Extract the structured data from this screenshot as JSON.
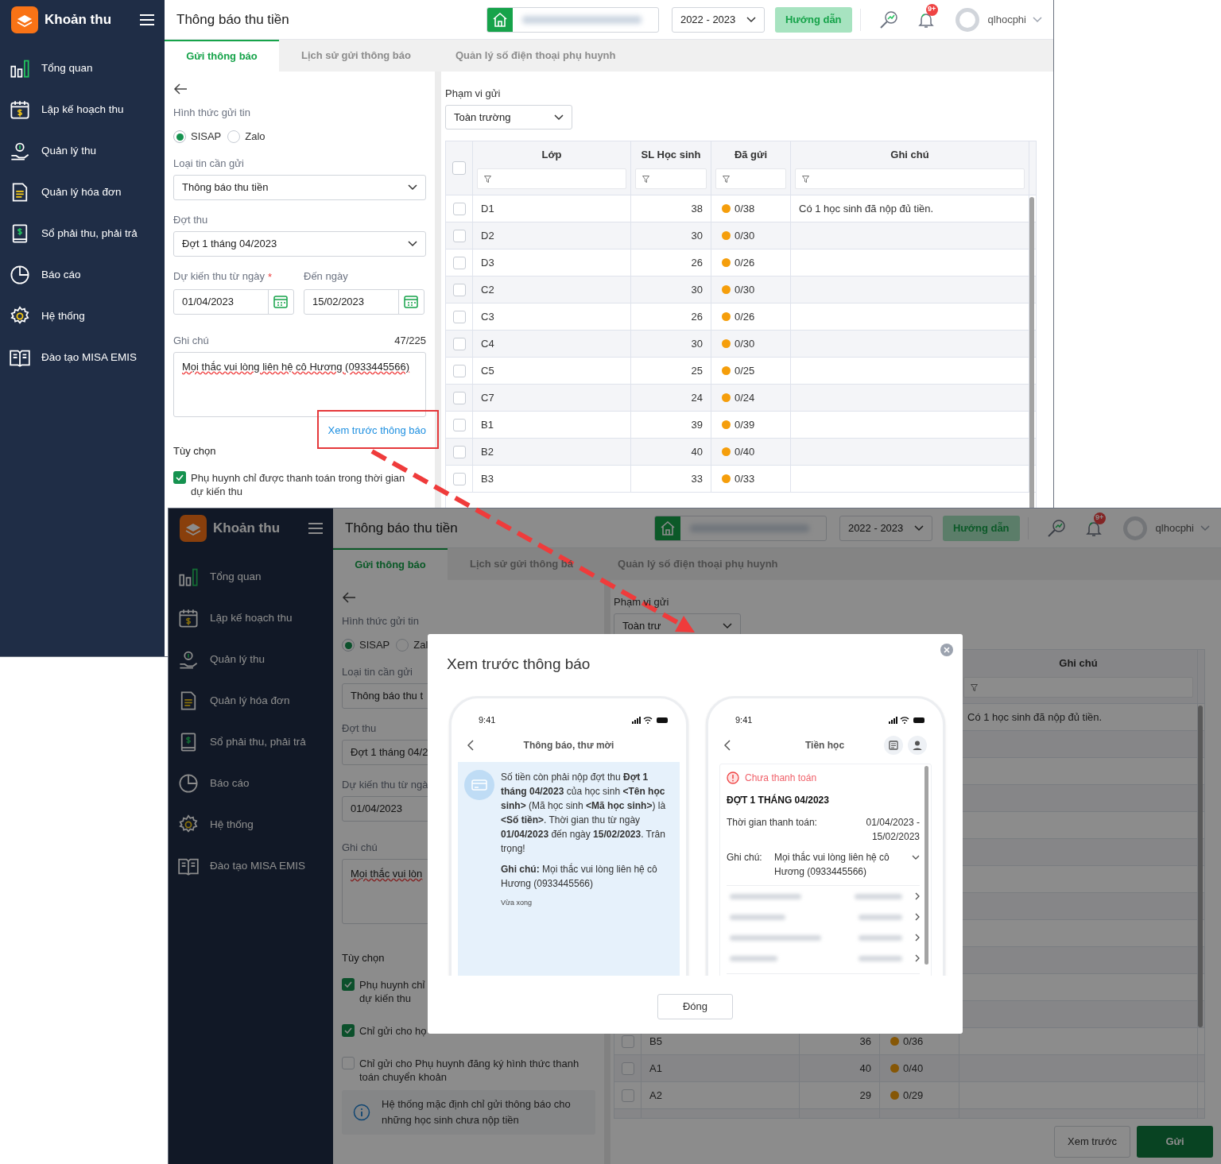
{
  "screens": [
    {
      "sidebar": {
        "app_title": "Khoản thu",
        "items": [
          {
            "label": "Tổng quan"
          },
          {
            "label": "Lập kế hoạch thu"
          },
          {
            "label": "Quản lý thu"
          },
          {
            "label": "Quản lý hóa đơn"
          },
          {
            "label": "Sổ phải thu, phải trả"
          },
          {
            "label": "Báo cáo"
          },
          {
            "label": "Hệ thống"
          },
          {
            "label": "Đào tạo MISA EMIS"
          }
        ]
      },
      "header": {
        "page_title": "Thông báo thu tiền",
        "school_year": "2022 - 2023",
        "guide_button": "Hướng dẫn",
        "notification_badge": "9+",
        "username": "qlhocphi"
      },
      "tabs": [
        {
          "label": "Gửi thông báo",
          "selected": true
        },
        {
          "label": "Lịch sử gửi thông báo",
          "selected": false
        },
        {
          "label": "Quản lý số điện thoại phụ huynh",
          "selected": false
        }
      ],
      "form": {
        "channel_label": "Hình thức gửi tin",
        "channels": [
          {
            "label": "SISAP",
            "selected": true
          },
          {
            "label": "Zalo",
            "selected": false
          }
        ],
        "type_label": "Loại tin cần gửi",
        "type_value": "Thông báo thu tiền",
        "period_label": "Đợt thu",
        "period_value": "Đợt 1 tháng 04/2023",
        "from_label": "Dự kiến thu từ ngày",
        "required_mark": "*",
        "to_label": "Đến ngày",
        "from_value": "01/04/2023",
        "to_value": "15/02/2023",
        "note_label": "Ghi chú",
        "note_count": "47/225",
        "note_value": "Mọi thắc vui lòng liên hệ cô Hương (0933445566)",
        "preview_link": "Xem trước thông báo",
        "options_label": "Tùy chọn",
        "options": [
          {
            "lines": [
              "Phụ huynh chỉ được thanh toán trong thời gian",
              "dự kiến thu"
            ],
            "checked": true
          }
        ]
      },
      "scope": {
        "label": "Phạm vi gửi",
        "value": "Toàn trường"
      },
      "table": {
        "select_all_checked": false,
        "columns": {
          "class": "Lớp",
          "students": "SL Học sinh",
          "sent": "Đã gửi",
          "note": "Ghi chú"
        },
        "rows": [
          {
            "class": "D1",
            "students": "38",
            "sent": "0/38",
            "note": "Có 1 học sinh đã nộp đủ tiền.",
            "checked": false
          },
          {
            "class": "D2",
            "students": "30",
            "sent": "0/30",
            "checked": false
          },
          {
            "class": "D3",
            "students": "26",
            "sent": "0/26",
            "checked": false
          },
          {
            "class": "C2",
            "students": "30",
            "sent": "0/30",
            "checked": false
          },
          {
            "class": "C3",
            "students": "26",
            "sent": "0/26",
            "checked": false
          },
          {
            "class": "C4",
            "students": "30",
            "sent": "0/30",
            "checked": false
          },
          {
            "class": "C5",
            "students": "25",
            "sent": "0/25",
            "checked": false
          },
          {
            "class": "C7",
            "students": "24",
            "sent": "0/24",
            "checked": false
          },
          {
            "class": "B1",
            "students": "39",
            "sent": "0/39",
            "checked": false
          },
          {
            "class": "B2",
            "students": "40",
            "sent": "0/40",
            "checked": false
          },
          {
            "class": "B3",
            "students": "33",
            "sent": "0/33",
            "checked": false
          }
        ]
      }
    },
    {
      "sidebar": {
        "app_title": "Khoản thu",
        "items": [
          {
            "label": "Tổng quan"
          },
          {
            "label": "Lập kế hoạch thu"
          },
          {
            "label": "Quản lý thu"
          },
          {
            "label": "Quản lý hóa đơn"
          },
          {
            "label": "Sổ phải thu, phải trả"
          },
          {
            "label": "Báo cáo"
          },
          {
            "label": "Hệ thống"
          },
          {
            "label": "Đào tạo MISA EMIS"
          }
        ]
      },
      "header": {
        "page_title": "Thông báo thu tiền",
        "school_year": "2022 - 2023",
        "guide_button": "Hướng dẫn",
        "notification_badge": "9+",
        "username": "qlhocphi"
      },
      "tabs": [
        {
          "label": "Gửi thông báo",
          "selected": true
        },
        {
          "label": "Lịch sử gửi thông bá",
          "selected": false
        },
        {
          "label": "Quản lý số điện thoại phụ huynh",
          "selected": false
        }
      ],
      "form": {
        "channel_label": "Hình thức gửi tin",
        "channels": [
          {
            "label": "SISAP",
            "selected": true
          },
          {
            "label": "Zal",
            "selected": false
          }
        ],
        "type_label": "Loại tin cần gửi",
        "type_value": "Thông báo thu t",
        "period_label": "Đợt thu",
        "period_value": "Đợt 1 tháng 04/2",
        "from_label": "Dự kiến thu từ ngà",
        "from_value": "01/04/2023",
        "note_label": "Ghi chú",
        "note_value": "Mọi thắc vui lòn",
        "options_label": "Tùy chọn",
        "options": [
          {
            "lines": [
              "Phụ huynh chỉ",
              "dự kiến thu"
            ],
            "checked": true
          },
          {
            "lines": [
              "Chỉ gửi cho họ"
            ],
            "checked": true
          },
          {
            "lines": [
              "Chỉ gửi cho Phụ huynh đăng ký hình thức thanh",
              "toán chuyển khoản"
            ],
            "checked": false
          }
        ],
        "info": "Hệ thống mặc định chỉ gửi thông báo cho những học sinh chưa nộp tiền"
      },
      "scope": {
        "label": "Phạm vi gửi",
        "value": "Toàn trư"
      },
      "table": {
        "columns": {
          "note": "Ghi chú"
        },
        "rows": [
          {
            "note": "Có 1 học sinh đã nộp đủ tiền."
          }
        ],
        "rows_below_dialog": [
          {
            "class": "B5",
            "students": "36",
            "sent": "0/36",
            "checked": false
          },
          {
            "class": "A1",
            "students": "40",
            "sent": "0/40",
            "checked": false
          },
          {
            "class": "A2",
            "students": "29",
            "sent": "0/29",
            "checked": false
          }
        ]
      },
      "footer_buttons": {
        "preview": "Xem trước",
        "send": "Gửi"
      },
      "dialog": {
        "title": "Xem trước thông báo",
        "close_button": "Đóng",
        "inbox_phone": {
          "time": "9:41",
          "title": "Thông báo, thư mời",
          "message": "Số tiền còn phải nộp đợt thu **Đợt 1 tháng 04/2023** của học sinh **<Tên học sinh>** (Mã học sinh **<Mã học sinh>**) là **<Số tiền>**. Thời gian thu từ ngày **01/04/2023** đến ngày **15/02/2023**. Trân trọng!",
          "note": "**Ghi chú:** Mọi thắc vui lòng liên hệ cô Hương (0933445566)",
          "timestamp": "Vừa xong"
        },
        "fee_phone": {
          "time": "9:41",
          "title": "Tiền học",
          "status": "Chưa thanh toán",
          "period": "ĐỢT 1 THÁNG 04/2023",
          "pay_time_label": "Thời gian thanh toán:",
          "pay_time_value": "01/04/2023 - 15/02/2023",
          "note_label": "Ghi chú:",
          "note_value": "Mọi thắc vui lòng liên hệ cô Hương (0933445566)"
        }
      }
    }
  ]
}
